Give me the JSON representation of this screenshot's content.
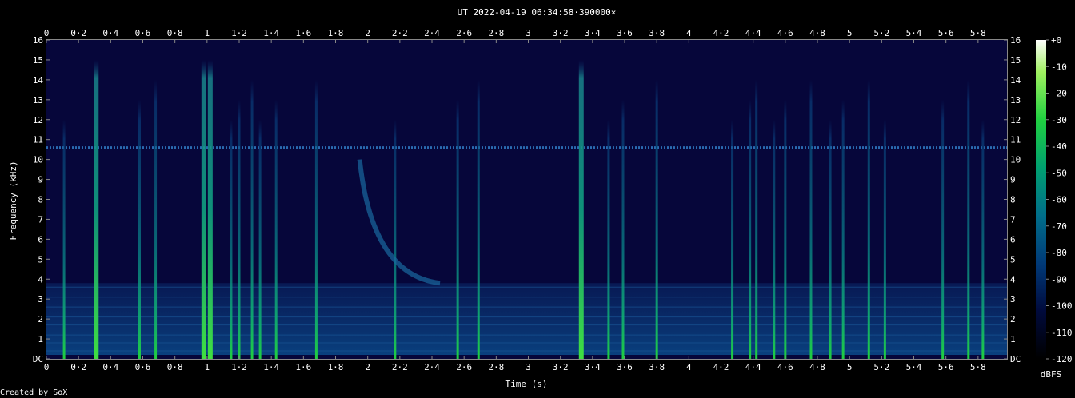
{
  "chart_data": {
    "type": "heatmap",
    "title": "UT 2022-04-19 06:34:58·390000×",
    "xlabel": "Time (s)",
    "ylabel": "Frequency (kHz)",
    "colorbar_label": "dBFS",
    "credit": "Created by SoX",
    "xlim": [
      0,
      5.98
    ],
    "ylim": [
      0,
      16
    ],
    "x_ticks": [
      "0",
      "0·2",
      "0·4",
      "0·6",
      "0·8",
      "1",
      "1·2",
      "1·4",
      "1·6",
      "1·8",
      "2",
      "2·2",
      "2·4",
      "2·6",
      "2·8",
      "3",
      "3·2",
      "3·4",
      "3·6",
      "3·8",
      "4",
      "4·2",
      "4·4",
      "4·6",
      "4·8",
      "5",
      "5·2",
      "5·4",
      "5·6",
      "5·8"
    ],
    "y_ticks": [
      "DC",
      "1",
      "2",
      "3",
      "4",
      "5",
      "6",
      "7",
      "8",
      "9",
      "10",
      "11",
      "12",
      "13",
      "14",
      "15",
      "16"
    ],
    "colorbar_ticks": [
      "+0",
      "-10",
      "-20",
      "-30",
      "-40",
      "-50",
      "-60",
      "-70",
      "-80",
      "-90",
      "-100",
      "-110",
      "-120"
    ],
    "colorbar_range": [
      -120,
      0
    ],
    "colors": {
      "background": "#000000",
      "noise_floor": "#06063a",
      "colormap": [
        "#000000",
        "#000a3c",
        "#003a78",
        "#006e8a",
        "#00a070",
        "#20d040",
        "#a0f060",
        "#ffffff"
      ]
    },
    "features": {
      "carrier_line_khz": 10.6,
      "strong_transients_s": [
        0.31,
        0.98,
        1.02,
        3.33
      ],
      "transients_s": [
        0.11,
        0.58,
        0.68,
        1.15,
        1.2,
        1.28,
        1.33,
        1.43,
        1.68,
        2.17,
        2.56,
        2.69,
        3.5,
        3.59,
        3.8,
        4.27,
        4.38,
        4.42,
        4.53,
        4.6,
        4.76,
        4.88,
        4.96,
        5.12,
        5.22,
        5.58,
        5.74,
        5.83
      ],
      "descending_tone": {
        "start_s": 1.95,
        "end_s": 2.45,
        "start_khz": 10,
        "end_khz": 3.8
      },
      "low_band_khz": [
        0.2,
        3.8
      ]
    }
  }
}
